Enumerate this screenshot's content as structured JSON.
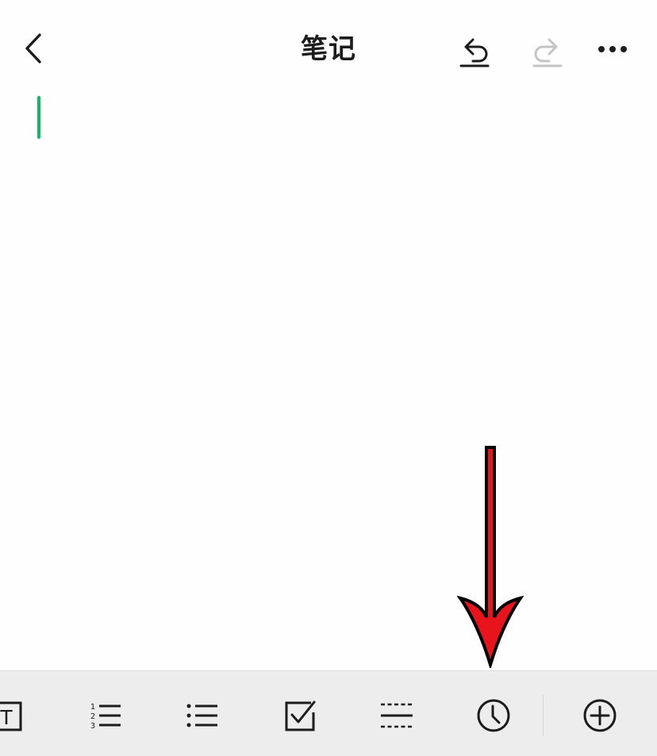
{
  "nav": {
    "title": "笔记"
  },
  "editor": {
    "content": ""
  },
  "colors": {
    "caret": "#07c160",
    "toolbar_bg": "#ededed",
    "annotation_arrow": "#e8141c",
    "icon": "#1c1c1c",
    "disabled_icon": "#c4c4c4"
  },
  "icons": {
    "back": "chevron-left-icon",
    "undo": "undo-icon",
    "redo": "redo-icon",
    "more": "more-dots-icon",
    "text_style": "text-format-icon",
    "ordered_list": "numbered-list-icon",
    "bullet_list": "bullet-list-icon",
    "checkbox": "checkbox-icon",
    "divider": "divider-line-icon",
    "clock": "clock-icon",
    "add": "plus-circle-icon"
  },
  "toolbar": {
    "ordered_list_numbers": [
      "1",
      "2",
      "3"
    ],
    "text_style_glyph": "T"
  }
}
